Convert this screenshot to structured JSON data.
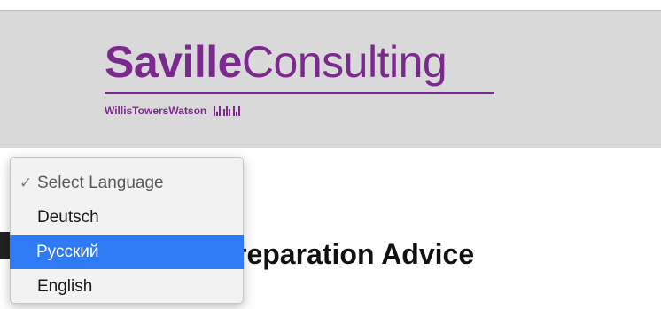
{
  "header": {
    "logo": {
      "word_bold": "Saville",
      "word_light": "Consulting",
      "subtitle": "WillisTowersWatson"
    }
  },
  "main": {
    "heading_visible": "reparation Advice"
  },
  "language_dropdown": {
    "check_icon": "check-icon",
    "items": [
      {
        "label": "Select Language",
        "state": "checked"
      },
      {
        "label": "Deutsch",
        "state": "normal"
      },
      {
        "label": "Русский",
        "state": "highlighted"
      },
      {
        "label": "English",
        "state": "normal"
      }
    ]
  },
  "colors": {
    "brand_purple": "#7a2a8c",
    "header_gray": "#d9d9d9",
    "menu_highlight": "#2f7bf6",
    "menu_background": "#f2f2f2"
  }
}
